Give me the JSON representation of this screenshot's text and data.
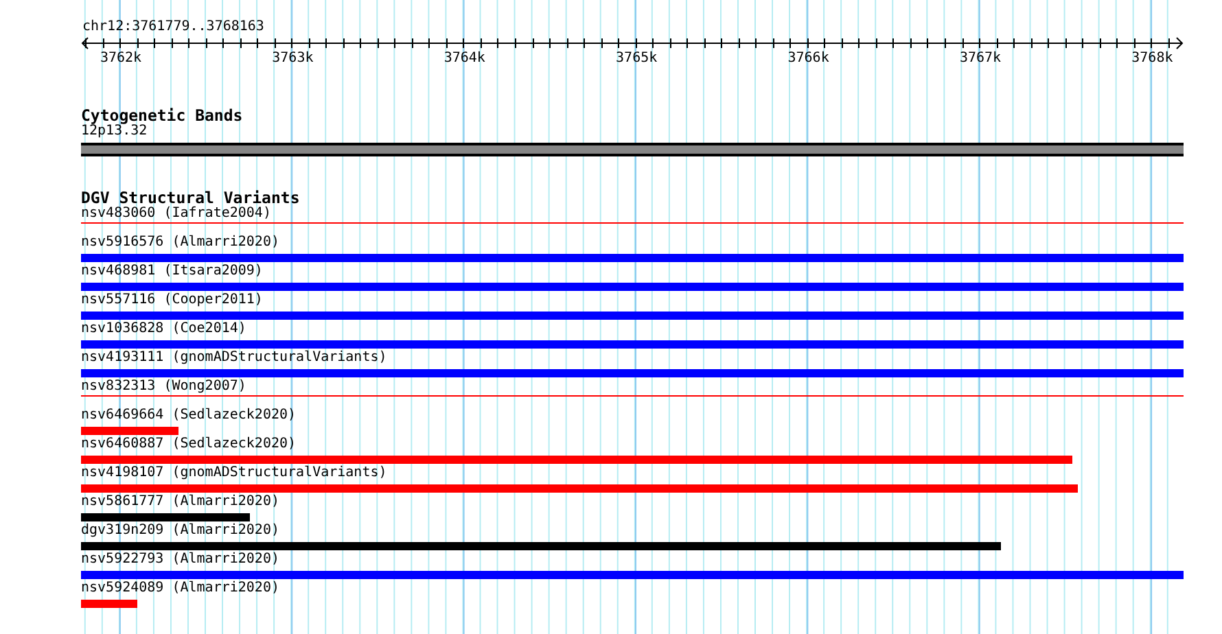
{
  "ruler": {
    "title": "chr12:3761779..3768163",
    "ticks": [
      "3762k",
      "3763k",
      "3764k",
      "3765k",
      "3766k",
      "3767k",
      "3768k"
    ]
  },
  "cytogenetic_bands": {
    "title": "Cytogenetic Bands",
    "band": "12p13.32"
  },
  "dgv_track": {
    "title": "DGV Structural Variants",
    "features": [
      {
        "label": "nsv483060 (Iafrate2004)",
        "kind": "thin",
        "color": "#ff0000",
        "level": 1
      },
      {
        "label": "nsv5916576 (Almarri2020)",
        "kind": "bar",
        "color": "#0000ff",
        "level": 1
      },
      {
        "label": "nsv468981 (Itsara2009)",
        "kind": "bar",
        "color": "#0000ff",
        "level": 1
      },
      {
        "label": "nsv557116 (Cooper2011)",
        "kind": "bar",
        "color": "#0000ff",
        "level": 1
      },
      {
        "label": "nsv1036828 (Coe2014)",
        "kind": "bar",
        "color": "#0000ff",
        "level": 1
      },
      {
        "label": "nsv4193111 (gnomADStructuralVariants)",
        "kind": "bar",
        "color": "#0000ff",
        "level": 1
      },
      {
        "label": "nsv832313 (Wong2007)",
        "kind": "thin",
        "color": "#ff0000",
        "level": 1
      },
      {
        "label": "nsv6469664 (Sedlazeck2020)",
        "kind": "bar",
        "color": "#ff0000",
        "level": 0.088
      },
      {
        "label": "nsv6460887 (Sedlazeck2020)",
        "kind": "bar",
        "color": "#ff0000",
        "level": 0.899
      },
      {
        "label": "nsv4198107 (gnomADStructuralVariants)",
        "kind": "bar",
        "color": "#ff0000",
        "level": 0.904
      },
      {
        "label": "nsv5861777 (Almarri2020)",
        "kind": "bar",
        "color": "#000000",
        "level": 0.153
      },
      {
        "label": "dgv319n209 (Almarri2020)",
        "kind": "bar",
        "color": "#000000",
        "level": 0.834
      },
      {
        "label": "nsv5922793 (Almarri2020)",
        "kind": "bar",
        "color": "#0000ff",
        "level": 1
      },
      {
        "label": "nsv5924089 (Almarri2020)",
        "kind": "bar",
        "color": "#ff0000",
        "level": 0.051
      }
    ]
  }
}
